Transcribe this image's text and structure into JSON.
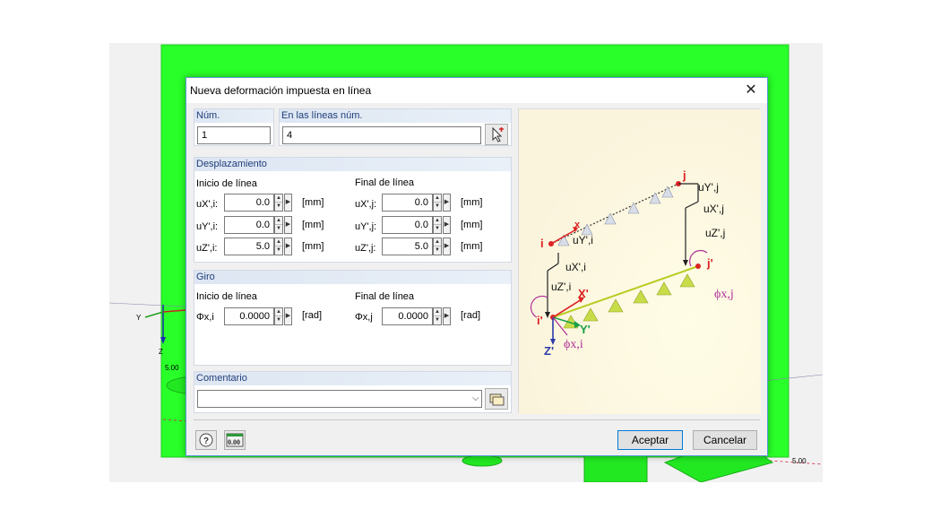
{
  "viewport": {
    "labels": {
      "y_axis": "Y",
      "z_axis": "Z",
      "value_left": "5.00",
      "value_right": "5.00"
    }
  },
  "dialog": {
    "title": "Nueva deformación impuesta en línea",
    "close_glyph": "✕",
    "num": {
      "label": "Núm.",
      "value": "1"
    },
    "lines": {
      "label": "En las líneas núm.",
      "value": "4"
    },
    "displacement": {
      "heading": "Desplazamiento",
      "start_heading": "Inicio de línea",
      "end_heading": "Final de línea",
      "rows": [
        {
          "start_label": "uX',i:",
          "start_value": "0.0",
          "end_label": "uX',j:",
          "end_value": "0.0",
          "unit": "[mm]"
        },
        {
          "start_label": "uY',i:",
          "start_value": "0.0",
          "end_label": "uY',j:",
          "end_value": "0.0",
          "unit": "[mm]"
        },
        {
          "start_label": "uZ',i:",
          "start_value": "5.0",
          "end_label": "uZ',j:",
          "end_value": "5.0",
          "unit": "[mm]"
        }
      ]
    },
    "rotation": {
      "heading": "Giro",
      "start_heading": "Inicio de línea",
      "end_heading": "Final de línea",
      "start_label": "Φx,i",
      "start_value": "0.0000",
      "end_label": "Φx,j",
      "end_value": "0.0000",
      "unit": "[rad]"
    },
    "comment": {
      "heading": "Comentario",
      "value": ""
    },
    "illustration": {
      "labels": {
        "j": "j",
        "i": "i",
        "x": "x",
        "j_prime": "j'",
        "i_prime": "i'",
        "uYj": "uY',j",
        "uXj": "uX',j",
        "uZj": "uZ',j",
        "uYi": "uY',i",
        "uXi": "uX',i",
        "uZi": "uZ',i",
        "phixj": "ϕx,j",
        "phixi": "ϕx,i",
        "Xp": "X'",
        "Yp": "Y'",
        "Zp": "Z'"
      }
    },
    "buttons": {
      "accept": "Aceptar",
      "cancel": "Cancelar",
      "help_glyph": "?",
      "units_glyph": "0.00"
    }
  }
}
